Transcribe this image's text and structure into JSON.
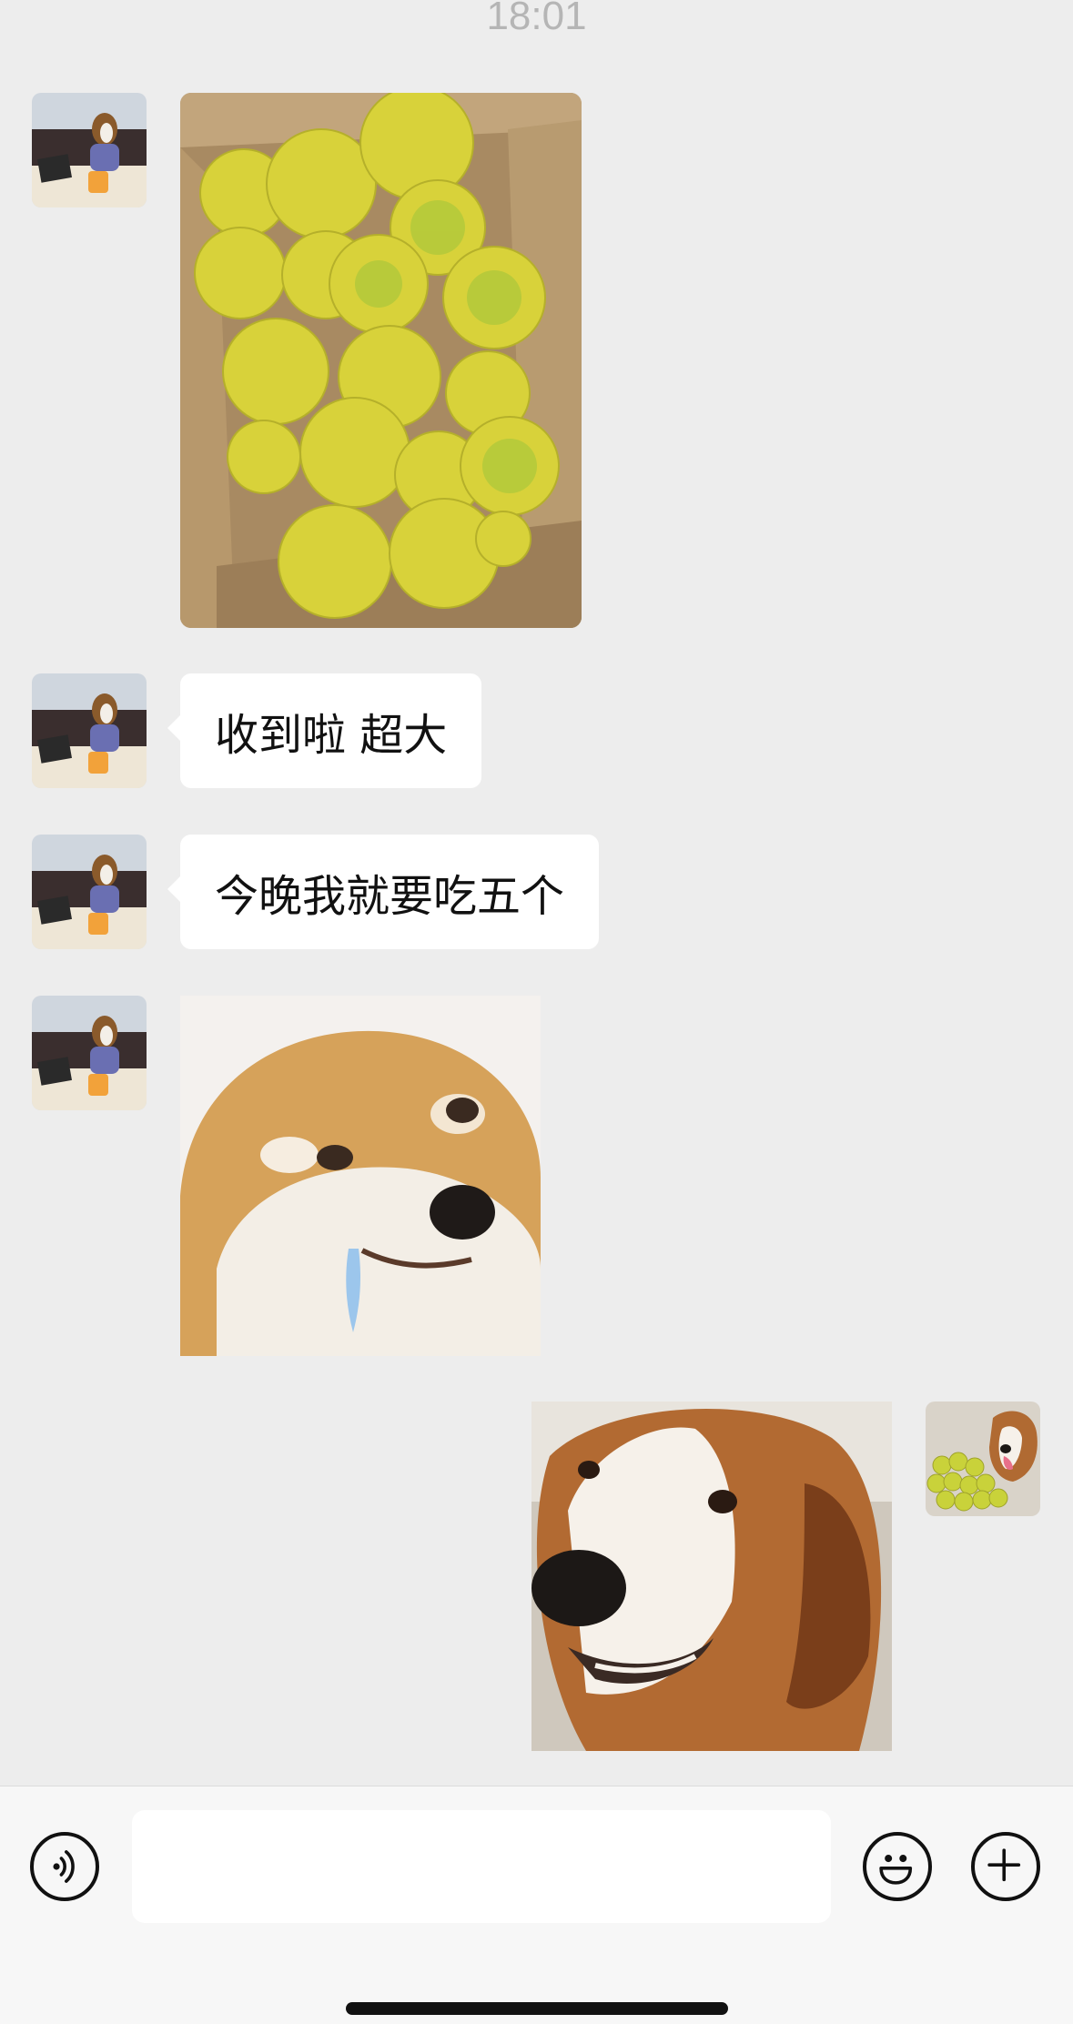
{
  "status": {
    "time": "18:01"
  },
  "messages": [
    {
      "side": "left",
      "type": "image",
      "image": "box-of-green-yellow-passion-fruit"
    },
    {
      "side": "left",
      "type": "text",
      "text": "收到啦 超大"
    },
    {
      "side": "left",
      "type": "text",
      "text": "今晚我就要吃五个"
    },
    {
      "side": "left",
      "type": "sticker",
      "image": "drooling-shiba-inu"
    },
    {
      "side": "right",
      "type": "sticker",
      "image": "smiling-beagle"
    }
  ],
  "avatars": {
    "contact": "dog-at-desk-avatar",
    "self": "beagle-with-fruit-avatar"
  },
  "input_bar": {
    "value": "",
    "icons": [
      "voice-icon",
      "emoji-icon",
      "plus-icon"
    ]
  },
  "colors": {
    "background": "#ededed",
    "bubble": "#ffffff",
    "input_bar": "#f7f7f7",
    "text": "#111111"
  }
}
